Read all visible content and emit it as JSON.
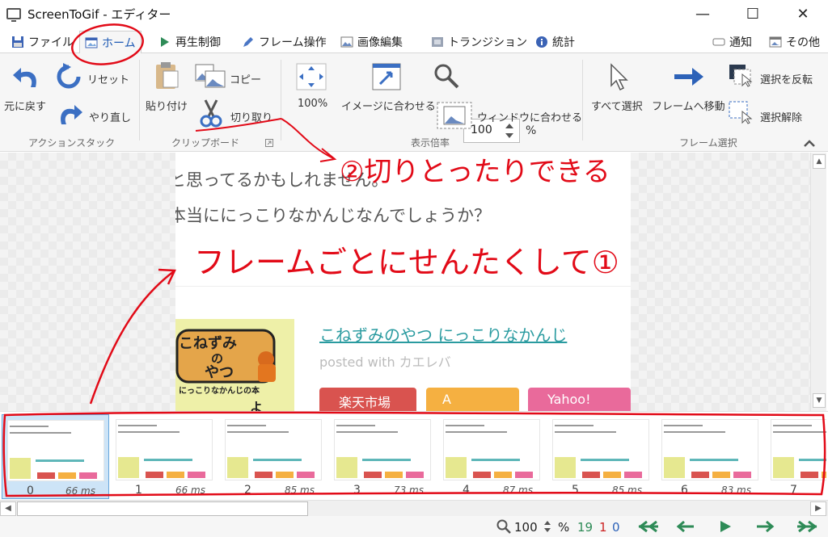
{
  "window": {
    "title": "ScreenToGif - エディター",
    "minimize": "—",
    "maximize": "☐",
    "close": "✕"
  },
  "tabs": [
    {
      "label": "ファイル",
      "icon": "save-icon"
    },
    {
      "label": "ホーム",
      "icon": "image-icon"
    },
    {
      "label": "再生制御",
      "icon": "play-icon"
    },
    {
      "label": "フレーム操作",
      "icon": "pencil-icon"
    },
    {
      "label": "画像編集",
      "icon": "picture-icon"
    },
    {
      "label": "トランジション",
      "icon": "transition-icon"
    },
    {
      "label": "統計",
      "icon": "info-icon"
    }
  ],
  "tab_right": {
    "notify": "通知",
    "other": "その他"
  },
  "ribbon": {
    "undo": "元に戻す",
    "reset": "リセット",
    "redo": "やり直し",
    "action_group": "アクションスタック",
    "paste": "貼り付け",
    "copy": "コピー",
    "cut": "切り取り",
    "clipboard_group": "クリップボード",
    "zoom_100": "100%",
    "fit_image": "イメージに合わせる",
    "zoom_value": "100",
    "zoom_unit": "%",
    "fit_window": "ウィンドウに合わせる",
    "zoom_group": "表示倍率",
    "select_all": "すべて選択",
    "goto_frame": "フレームへ移動",
    "invert_selection": "選択を反転",
    "deselect": "選択解除",
    "select_group": "フレーム選択"
  },
  "canvas": {
    "line1": "と思ってるかもしれません。",
    "line2": "本当ににっこりなかんじなんでしょうか？",
    "book_title1": "こねずみ",
    "book_title2": "の",
    "book_title3": "やつ",
    "book_sub": "にっこりなかんじの本",
    "book_extra": "よ",
    "link": "こねずみのやつ にっこりなかんじ",
    "posted": "posted with カエレバ",
    "btn1_label": "楽天市場",
    "btn2_label": "A",
    "btn3_label": "Yahoo!"
  },
  "frames": [
    {
      "index": "0",
      "delay": "66 ms"
    },
    {
      "index": "1",
      "delay": "66 ms"
    },
    {
      "index": "2",
      "delay": "85 ms"
    },
    {
      "index": "3",
      "delay": "73 ms"
    },
    {
      "index": "4",
      "delay": "87 ms"
    },
    {
      "index": "5",
      "delay": "85 ms"
    },
    {
      "index": "6",
      "delay": "83 ms"
    },
    {
      "index": "7",
      "delay": ""
    }
  ],
  "status": {
    "zoom": "100",
    "zoom_unit": "%",
    "count_total": "19",
    "count_selected": "1",
    "count_current": "0"
  },
  "annotations": {
    "cut_note": "②切りとったりできる",
    "select_note": "フレームごとにせんたくして①"
  },
  "colors": {
    "accent": "#1e5ab4",
    "annotation": "#e20a17",
    "frame_selected": "#cde4f7",
    "nav_green": "#2e8b57"
  }
}
